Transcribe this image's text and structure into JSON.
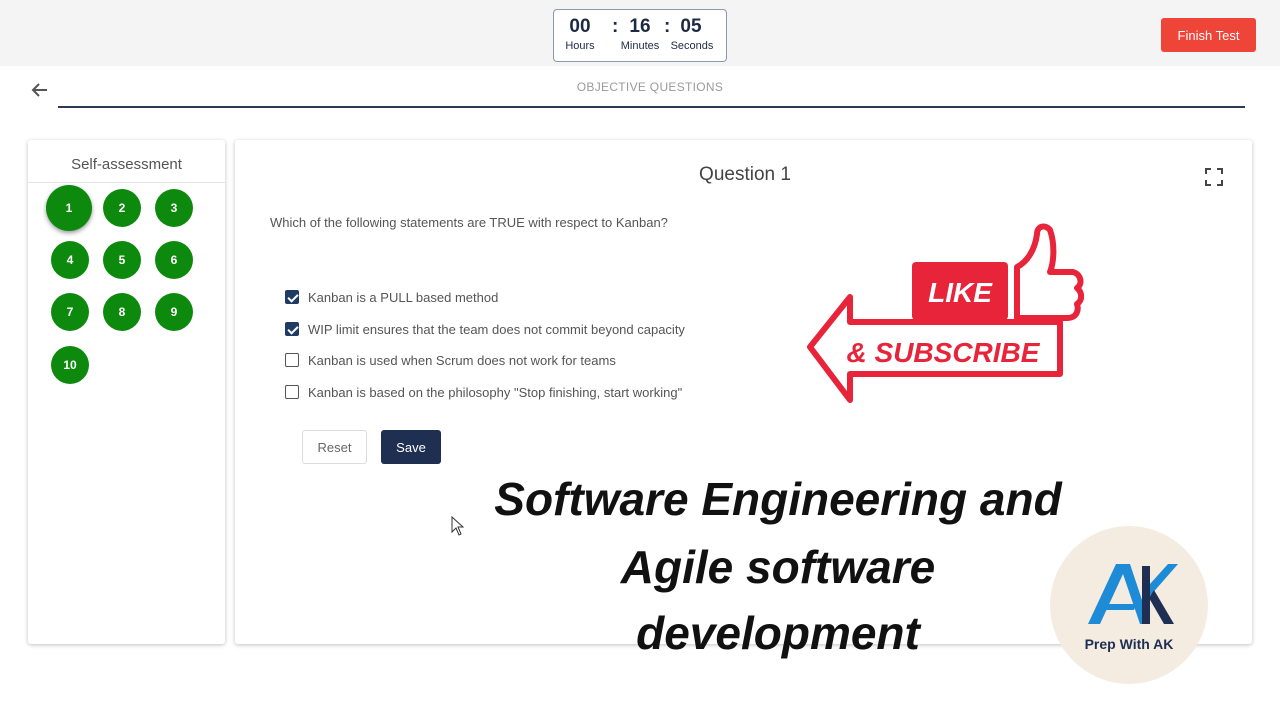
{
  "timer": {
    "hours": "00",
    "minutes": "16",
    "seconds": "05",
    "hours_label": "Hours",
    "minutes_label": "Minutes",
    "seconds_label": "Seconds",
    "separator": ":"
  },
  "finish_button": "Finish Test",
  "section_title": "OBJECTIVE QUESTIONS",
  "sidebar": {
    "title": "Self-assessment",
    "questions": [
      "1",
      "2",
      "3",
      "4",
      "5",
      "6",
      "7",
      "8",
      "9",
      "10"
    ],
    "active_index": 0
  },
  "question": {
    "title": "Question 1",
    "text": "Which of the following statements are TRUE with respect to Kanban?",
    "options": [
      {
        "label": "Kanban is a PULL based method",
        "checked": true
      },
      {
        "label": "WIP limit ensures that the team does not commit beyond capacity",
        "checked": true
      },
      {
        "label": "Kanban is used when Scrum does not work for teams",
        "checked": false
      },
      {
        "label": "Kanban is based on the philosophy \"Stop finishing, start working\"",
        "checked": false
      }
    ],
    "reset_label": "Reset",
    "save_label": "Save"
  },
  "overlay": {
    "line1": "Software Engineering and",
    "line2": "Agile software",
    "line3": "development",
    "like": "LIKE",
    "subscribe": "& SUBSCRIBE",
    "brand_caption": "Prep With AK",
    "brand_letters": "AK"
  },
  "colors": {
    "accent_green": "#0d8a0d",
    "navy": "#1e2f52",
    "finish_red": "#ef4438",
    "like_red": "#e8243b"
  }
}
